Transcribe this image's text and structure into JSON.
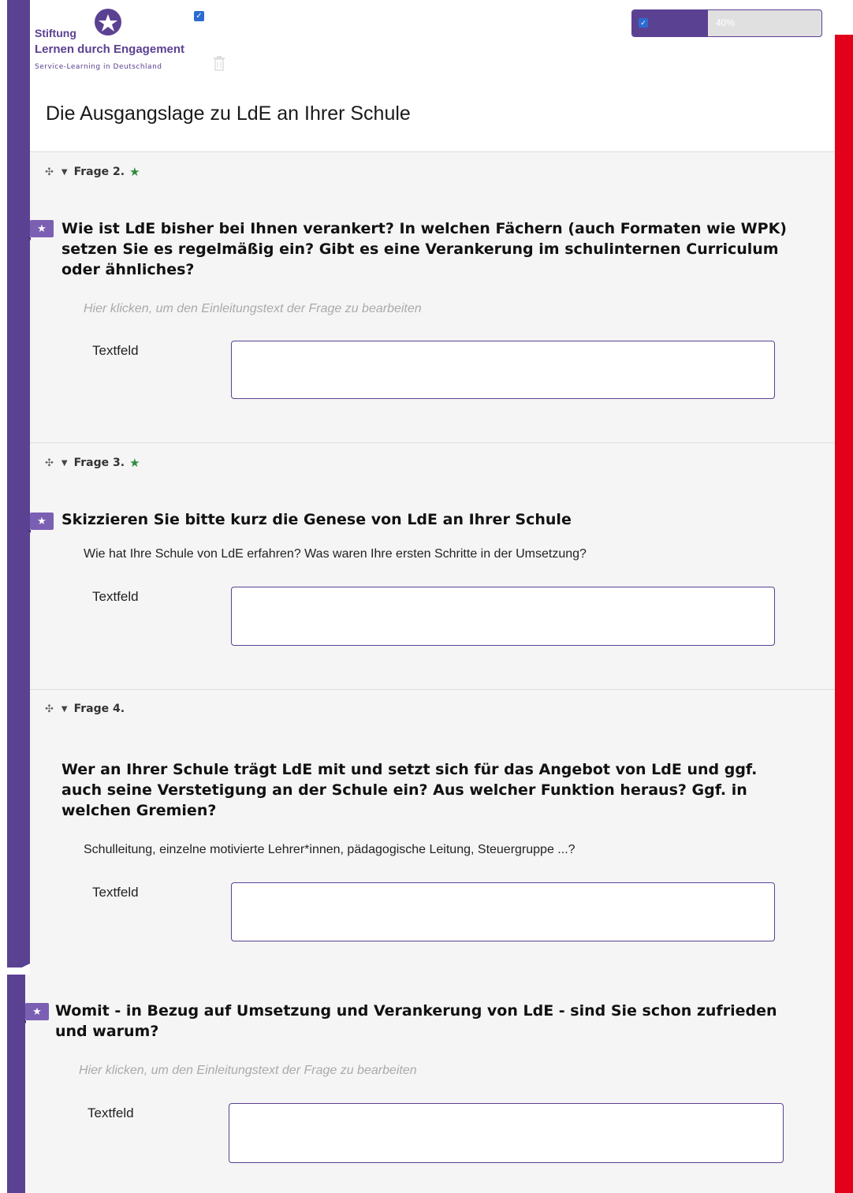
{
  "brand": {
    "line1": "Stiftung",
    "line2": "Lernen durch Engagement",
    "line3": "Service-Learning in Deutschland",
    "color": "#5b4192",
    "accent_red": "#e2001a"
  },
  "progress": {
    "value_percent": 40,
    "label": "40%"
  },
  "section": {
    "title": "Die Ausgangslage zu LdE an Ihrer Schule"
  },
  "questions": [
    {
      "header": "Frage 2.",
      "starred": true,
      "text": "Wie ist LdE bisher bei Ihnen verankert? In welchen Fächern (auch Formaten wie WPK) setzen Sie es regelmäßig ein? Gibt es eine Verankerung im schulinternen Curriculum oder ähnliches?",
      "help": "Hier klicken, um den Einleitungstext der Frage zu bearbeiten",
      "field_label": "Textfeld"
    },
    {
      "header": "Frage 3.",
      "starred": true,
      "text": "Skizzieren Sie bitte kurz die Genese von LdE an Ihrer Schule",
      "help": "Wie hat Ihre Schule von LdE erfahren? Was waren Ihre ersten Schritte in der Umsetzung?",
      "field_label": "Textfeld"
    },
    {
      "header": "Frage 4.",
      "starred": false,
      "text": "Wer an Ihrer Schule trägt LdE mit und setzt sich für das Angebot von LdE und ggf. auch seine Verstetigung an der Schule ein? Aus welcher Funktion heraus? Ggf. in welchen Gremien?",
      "help": "Schulleitung, einzelne motivierte Lehrer*innen, pädagogische Leitung, Steuergruppe ...?",
      "field_label": "Textfeld"
    },
    {
      "header": "",
      "starred": true,
      "text": "Womit - in Bezug auf Umsetzung und Verankerung von LdE - sind Sie schon zufrieden und warum?",
      "help": "Hier klicken, um den Einleitungstext der Frage zu bearbeiten",
      "field_label": "Textfeld"
    }
  ],
  "icons": {
    "move": "move-icon",
    "collapse": "caret-down-icon",
    "mandatory": "star-icon",
    "delete": "trash-icon",
    "checkbox": "checkbox-icon"
  }
}
